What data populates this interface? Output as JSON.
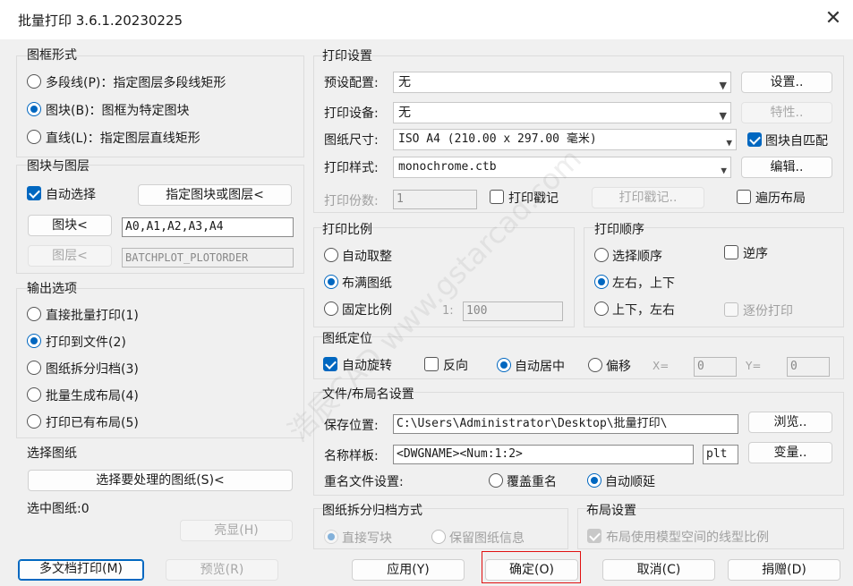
{
  "window": {
    "title": "批量打印 3.6.1.20230225",
    "close_symbol": "✕"
  },
  "frame_style": {
    "title": "图框形式",
    "options": [
      {
        "label": "多段线(P)：指定图层多段线矩形",
        "selected": false
      },
      {
        "label": "图块(B)：图框为特定图块",
        "selected": true
      },
      {
        "label": "直线(L)：指定图层直线矩形",
        "selected": false
      }
    ]
  },
  "block_layer": {
    "title": "图块与图层",
    "auto_select_label": "自动选择",
    "auto_select_checked": true,
    "specify_button": "指定图块或图层<",
    "block_button": "图块<",
    "block_value": "A0,A1,A2,A3,A4",
    "layer_button": "图层<",
    "layer_value": "BATCHPLOT_PLOTORDER"
  },
  "output": {
    "title": "输出选项",
    "options": [
      {
        "label": "直接批量打印(1)",
        "selected": false
      },
      {
        "label": "打印到文件(2)",
        "selected": true
      },
      {
        "label": "图纸拆分归档(3)",
        "selected": false
      },
      {
        "label": "批量生成布局(4)",
        "selected": false
      },
      {
        "label": "打印已有布局(5)",
        "selected": false
      }
    ]
  },
  "select_drawing": {
    "title": "选择图纸",
    "select_button": "选择要处理的图纸(S)<",
    "selected_label": "选中图纸:0",
    "highlight_button": "亮显(H)"
  },
  "print_settings": {
    "title": "打印设置",
    "preset_label": "预设配置:",
    "preset_value": "无",
    "settings_button": "设置..",
    "device_label": "打印设备:",
    "device_value": "无",
    "properties_button": "特性..",
    "paper_label": "图纸尺寸:",
    "paper_value": "ISO A4 (210.00 x 297.00 毫米)",
    "block_match_label": "图块自匹配",
    "block_match_checked": true,
    "style_label": "打印样式:",
    "style_value": "monochrome.ctb",
    "edit_button": "编辑..",
    "copies_label": "打印份数:",
    "copies_value": "1",
    "stamp_label": "打印戳记",
    "stamp_button": "打印戳记..",
    "traverse_label": "遍历布局"
  },
  "scale": {
    "title": "打印比例",
    "options": [
      {
        "label": "自动取整",
        "selected": false
      },
      {
        "label": "布满图纸",
        "selected": true
      },
      {
        "label": "固定比例",
        "selected": false
      }
    ],
    "ratio_prefix": "1:",
    "ratio_value": "100"
  },
  "order": {
    "title": "打印顺序",
    "options": [
      {
        "label": "选择顺序",
        "selected": false
      },
      {
        "label": "左右，上下",
        "selected": true
      },
      {
        "label": "上下，左右",
        "selected": false
      }
    ],
    "reverse_label": "逆序",
    "copy_print_label": "逐份打印"
  },
  "positioning": {
    "title": "图纸定位",
    "auto_rotate_label": "自动旋转",
    "auto_rotate_checked": true,
    "reverse_label": "反向",
    "auto_center_label": "自动居中",
    "offset_label": "偏移",
    "x_label": "X=",
    "x_value": "0",
    "y_label": "Y=",
    "y_value": "0"
  },
  "file_naming": {
    "title": "文件/布局名设置",
    "save_label": "保存位置:",
    "save_value": "C:\\Users\\Administrator\\Desktop\\批量打印\\",
    "browse_button": "浏览..",
    "template_label": "名称样板:",
    "template_value": "<DWGNAME><Num:1:2>",
    "ext_value": "plt",
    "variable_button": "变量..",
    "duplicate_label": "重名文件设置:",
    "overwrite_label": "覆盖重名",
    "auto_increment_label": "自动顺延"
  },
  "archive": {
    "title": "图纸拆分归档方式",
    "direct_label": "直接写块",
    "keep_label": "保留图纸信息"
  },
  "layout": {
    "title": "布局设置",
    "linetype_label": "布局使用模型空间的线型比例"
  },
  "watermark": "浩辰CAD www.gstarcad.com",
  "footer": {
    "multi_doc_button": "多文档打印(M)",
    "preview_button": "预览(R)",
    "apply_button": "应用(Y)",
    "ok_button": "确定(O)",
    "cancel_button": "取消(C)",
    "donate_button": "捐赠(D)"
  },
  "colors": {
    "accent": "#0067c0",
    "highlight": "#e01010"
  }
}
